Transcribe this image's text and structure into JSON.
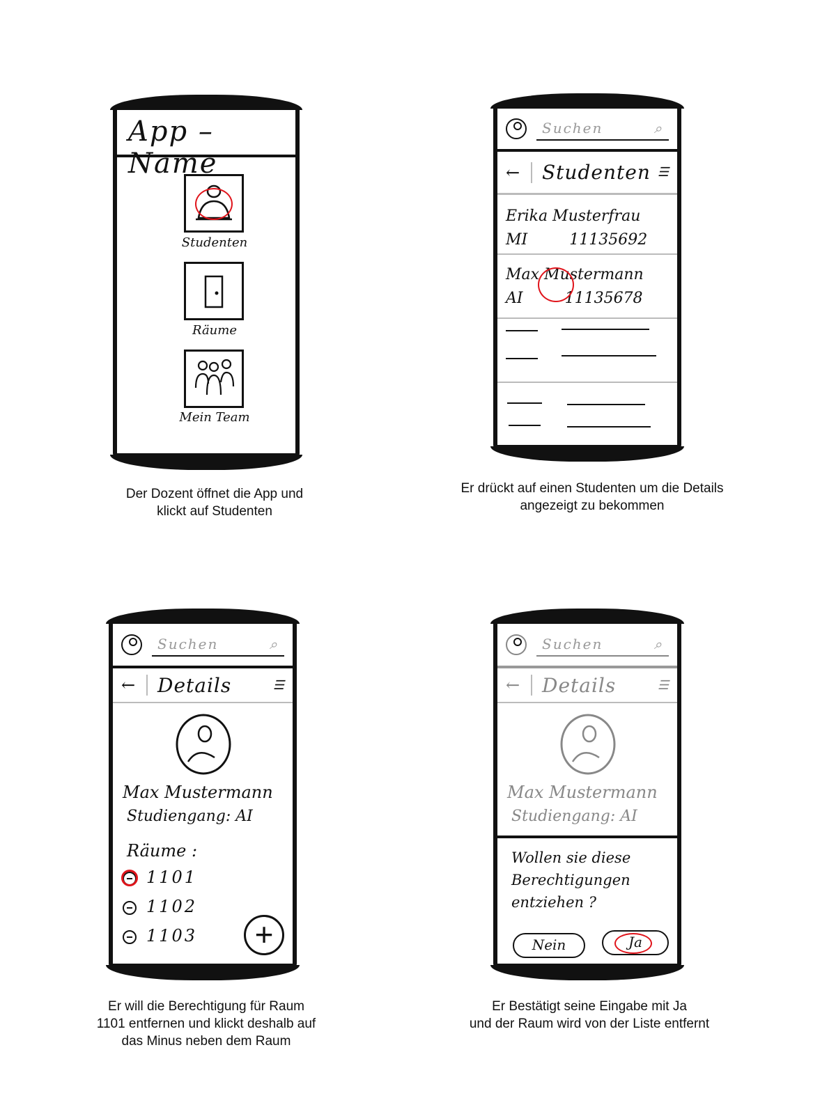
{
  "panel1": {
    "app_title": "App – Name",
    "tiles": [
      {
        "label": "Studenten",
        "icon": "person-icon"
      },
      {
        "label": "Räume",
        "icon": "door-icon"
      },
      {
        "label": "Mein Team",
        "icon": "team-icon"
      }
    ],
    "caption_line1": "Der Dozent öffnet die App und",
    "caption_line2": "klickt auf Studenten"
  },
  "panel2": {
    "search_placeholder": "Suchen",
    "title": "Studenten",
    "students": [
      {
        "name": "Erika Musterfrau",
        "course": "MI",
        "number": "11135692"
      },
      {
        "name": "Max Mustermann",
        "course": "AI",
        "number": "11135678"
      }
    ],
    "caption_line1": "Er drückt auf einen Studenten um die Details",
    "caption_line2": "angezeigt zu bekommen"
  },
  "panel3": {
    "search_placeholder": "Suchen",
    "title": "Details",
    "name": "Max Mustermann",
    "course": "Studiengang: AI",
    "rooms_label": "Räume :",
    "rooms": [
      "1101",
      "1102",
      "1103"
    ],
    "add_symbol": "+",
    "caption_line1": "Er will die Berechtigung für Raum",
    "caption_line2": "1101 entfernen und klickt deshalb auf",
    "caption_line3": "das Minus neben dem Raum"
  },
  "panel4": {
    "search_placeholder": "Suchen",
    "title": "Details",
    "name": "Max Mustermann",
    "course": "Studiengang: AI",
    "dialog_line1": "Wollen sie diese",
    "dialog_line2": "Berechtigungen",
    "dialog_line3": "entziehen ?",
    "no_label": "Nein",
    "yes_label": "Ja",
    "caption_line1": "Er Bestätigt seine Eingabe mit Ja",
    "caption_line2": "und der Raum wird von der Liste entfernt"
  },
  "colors": {
    "highlight": "#e0141b",
    "ink": "#111111",
    "muted": "#888888"
  }
}
